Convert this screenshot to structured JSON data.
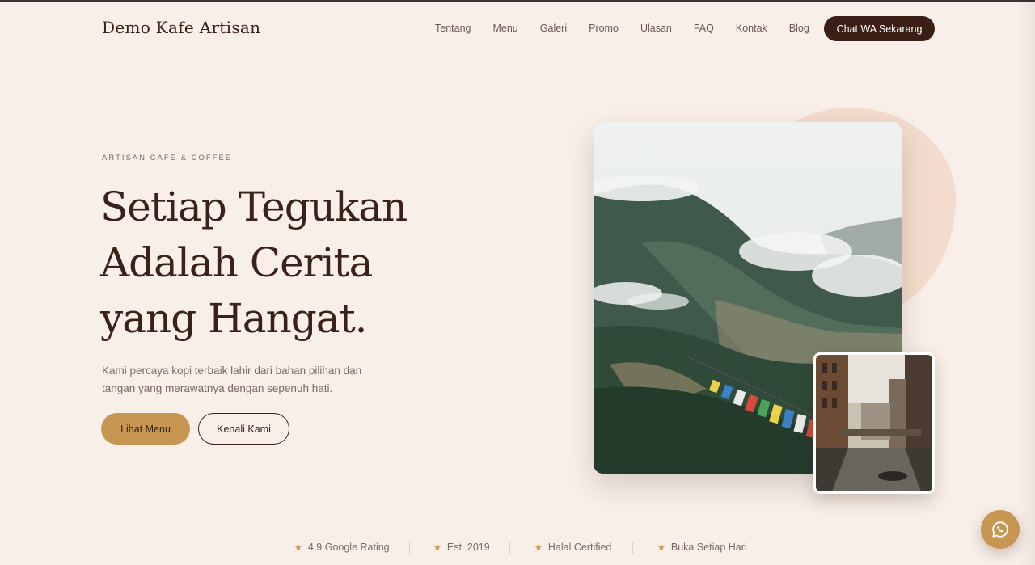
{
  "header": {
    "brand": "Demo Kafe Artisan",
    "nav": [
      "Tentang",
      "Menu",
      "Galeri",
      "Promo",
      "Ulasan",
      "FAQ",
      "Kontak",
      "Blog"
    ],
    "cta_label": "Chat WA Sekarang"
  },
  "hero": {
    "eyebrow": "ARTISAN CAFE & COFFEE",
    "headline_lines": [
      "Setiap Tegukan",
      "Adalah Cerita",
      "yang Hangat."
    ],
    "description": "Kami percaya kopi terbaik lahir dari bahan pilihan dan tangan yang merawatnya dengan sepenuh hati.",
    "primary_button": "Lihat Menu",
    "secondary_button": "Kenali Kami"
  },
  "features": [
    {
      "icon": "star-icon",
      "label": "4.9 Google Rating"
    },
    {
      "icon": "star-icon",
      "label": "Est. 2019"
    },
    {
      "icon": "star-icon",
      "label": "Halal Certified"
    },
    {
      "icon": "star-icon",
      "label": "Buka Setiap Hari"
    }
  ],
  "floating": {
    "icon": "whatsapp-icon"
  },
  "colors": {
    "background": "#f8efe8",
    "brand_dark": "#3b1f16",
    "accent": "#c79652",
    "muted_text": "#7a6a60",
    "blob": "#f3dccd"
  }
}
